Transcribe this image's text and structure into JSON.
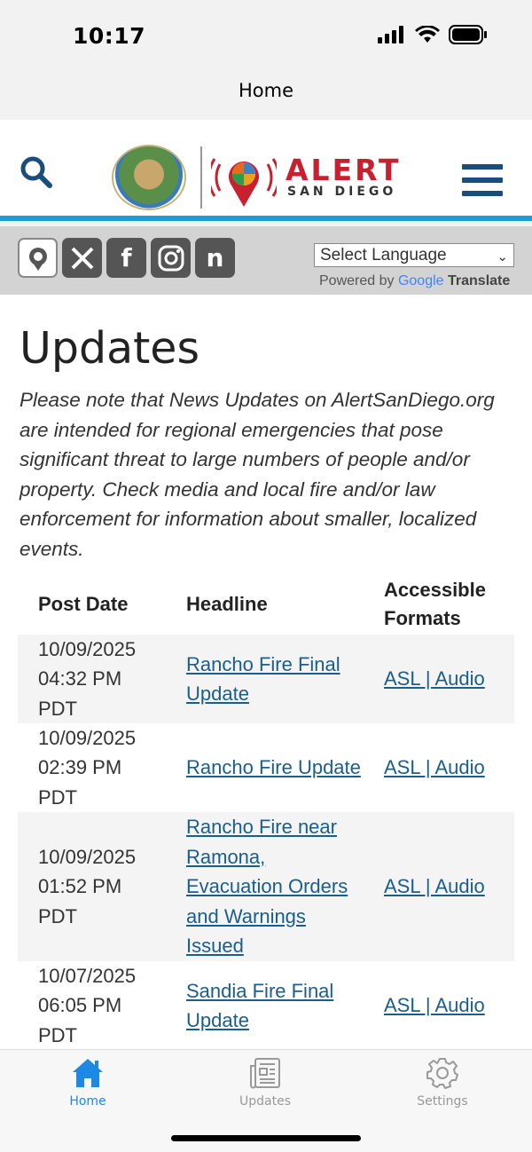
{
  "status_bar": {
    "time": "10:17"
  },
  "nav": {
    "title": "Home"
  },
  "header": {
    "alert_word": "ALERT",
    "alert_sub": "SAN DIEGO",
    "seal_text": "COUNTY OF SAN DIEGO"
  },
  "social": {
    "language_select": "Select Language",
    "powered_prefix": "Powered by",
    "google_word": "Google",
    "translate_word": "Translate",
    "icons": [
      "alert-app-icon",
      "x-icon",
      "facebook-icon",
      "instagram-icon",
      "nextdoor-icon"
    ]
  },
  "main": {
    "heading": "Updates",
    "notice": "Please note that News Updates on AlertSanDiego.org are intended for regional emergencies that pose significant threat to large numbers of people and/or property. Check media and local fire and/or law enforcement for information about smaller, localized events.",
    "columns": [
      "Post Date",
      "Headline",
      "Accessible Formats"
    ],
    "rows": [
      {
        "date": "10/09/2025 04:32 PM PDT",
        "headline": "Rancho Fire Final Update",
        "formats": "ASL | Audio"
      },
      {
        "date": "10/09/2025 02:39 PM PDT",
        "headline": "Rancho Fire Update",
        "formats": "ASL | Audio"
      },
      {
        "date": "10/09/2025 01:52 PM PDT",
        "headline": "Rancho Fire near Ramona, Evacuation Orders and Warnings Issued",
        "formats": "ASL | Audio"
      },
      {
        "date": "10/07/2025 06:05 PM PDT",
        "headline": "Sandia Fire Final Update",
        "formats": "ASL | Audio"
      }
    ]
  },
  "tabbar": {
    "tabs": [
      {
        "label": "Home",
        "icon": "home-icon",
        "active": true
      },
      {
        "label": "Updates",
        "icon": "newspaper-icon",
        "active": false
      },
      {
        "label": "Settings",
        "icon": "gear-icon",
        "active": false
      }
    ]
  },
  "colors": {
    "accent_blue": "#1e9ad6",
    "alert_red": "#c8202e",
    "link_blue": "#1a5e8f",
    "tab_active": "#1e88e5"
  }
}
